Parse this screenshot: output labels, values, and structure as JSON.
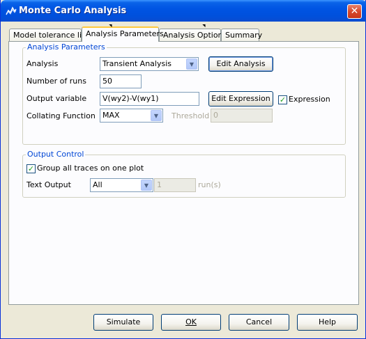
{
  "window": {
    "title": "Monte Carlo Analysis",
    "title_icon": "monte-carlo-app-icon",
    "close_label": "✕"
  },
  "tabs": [
    {
      "label": "Model tolerance list",
      "active": false
    },
    {
      "label": "Analysis Parameters",
      "active": true
    },
    {
      "label": "Analysis Options",
      "active": false
    },
    {
      "label": "Summary",
      "active": false
    }
  ],
  "analysis_parameters": {
    "group_title": "Analysis Parameters",
    "analysis_label": "Analysis",
    "analysis_value": "Transient Analysis",
    "edit_analysis_label": "Edit Analysis",
    "runs_label": "Number of runs",
    "runs_value": "50",
    "output_variable_label": "Output variable",
    "output_variable_value": "V(wy2)-V(wy1)",
    "edit_expression_label": "Edit Expression",
    "expression_checkbox_label": "Expression",
    "expression_checked": true,
    "collating_label": "Collating Function",
    "collating_value": "MAX",
    "threshold_label": "Threshold",
    "threshold_value": "0"
  },
  "output_control": {
    "group_title": "Output Control",
    "group_traces_label": "Group all traces on one plot",
    "group_traces_checked": true,
    "text_output_label": "Text Output",
    "text_output_value": "All",
    "runs_value": "1",
    "runs_suffix": "run(s)"
  },
  "footer": {
    "simulate_label": "Simulate",
    "ok_label": "OK",
    "cancel_label": "Cancel",
    "help_label": "Help"
  },
  "colors": {
    "titlebar": "#0054e3",
    "group_title": "#0046d5",
    "checkmark": "#21a121",
    "dialog_bg": "#ece9d8"
  }
}
